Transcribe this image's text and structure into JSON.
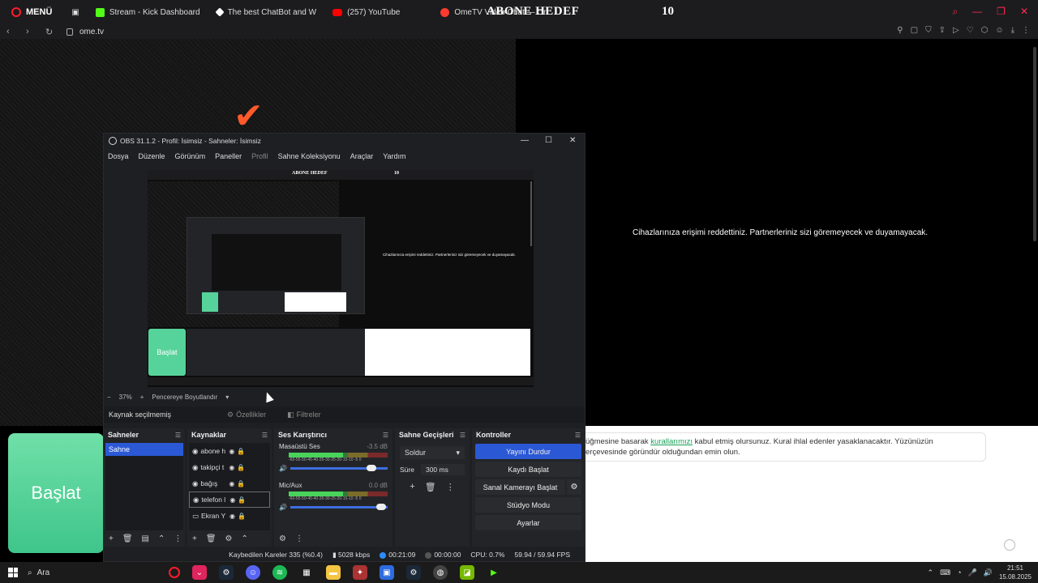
{
  "browser": {
    "menu_label": "MENÜ",
    "tabs": [
      {
        "label": "Stream - Kick Dashboard",
        "color": "#53fc18"
      },
      {
        "label": "The best ChatBot and W",
        "color": "#ffffff"
      },
      {
        "label": "(257) YouTube",
        "color": "#ff0000"
      },
      {
        "label": "OmeTV Video Chat — Or",
        "color": "#ff3b30"
      }
    ],
    "url": "ome.tv",
    "banner_title": "ABONE HEDEF",
    "banner_count": "10"
  },
  "page": {
    "deny_message": "Cihazlarınıza erişimi reddettiniz. Partnerleriniz sizi göremeyecek ve duyamayacak.",
    "start_label": "Başlat",
    "rules_pre": "üğmesine basarak ",
    "rules_link": "kurallarımızı",
    "rules_post": " kabul etmiş olursunuz. Kural ihlal edenler yasaklanacaktır. Yüzünüzün",
    "rules_line2": "erçevesinde göründür olduğundan emin olun."
  },
  "obs": {
    "title": "OBS 31.1.2 - Profil: İsimsiz - Sahneler: İsimsiz",
    "menu": [
      "Dosya",
      "Düzenle",
      "Görünüm",
      "Paneller",
      "Profil",
      "Sahne Koleksiyonu",
      "Araçlar",
      "Yardım"
    ],
    "preview_banner": "ABONE HEDEF",
    "preview_count": "10",
    "preview_start": "Başlat",
    "zoom": "37%",
    "fit_label": "Pencereye Boyutlandır",
    "no_source": "Kaynak seçilmemiş",
    "properties": "Özellikler",
    "filters": "Filtreler",
    "scenes": {
      "title": "Sahneler",
      "items": [
        "Sahne"
      ]
    },
    "sources": {
      "title": "Kaynaklar",
      "items": [
        "abone h",
        "takipçi t",
        "bağış",
        "telefon l",
        "Ekran Y"
      ]
    },
    "mixer": {
      "title": "Ses Karıştırıcı",
      "channels": [
        {
          "name": "Masaüstü Ses",
          "db": "-3.5 dB",
          "level": 0.55,
          "volume": 0.88
        },
        {
          "name": "Mic/Aux",
          "db": "0.0 dB",
          "level": 0.45,
          "volume": 1.0
        }
      ],
      "ticks": "-60-55-50-45-40-35-30-25-20-15-10 -5 0"
    },
    "transitions": {
      "title": "Sahne Geçişleri",
      "type": "Soldur",
      "duration_label": "Süre",
      "duration": "300 ms"
    },
    "controls": {
      "title": "Kontroller",
      "stop_stream": "Yayını Durdur",
      "start_record": "Kaydı Başlat",
      "virtual_cam": "Sanal Kamerayı Başlat",
      "studio_mode": "Stüdyo Modu",
      "settings": "Ayarlar"
    },
    "status": {
      "dropped": "Kaybedilen Kareler 335 (%0.4)",
      "bitrate": "5028 kbps",
      "stream_time": "00:21:09",
      "rec_time": "00:00:00",
      "cpu": "CPU: 0.7%",
      "fps": "59.94 / 59.94 FPS"
    }
  },
  "taskbar": {
    "search": "Ara",
    "time": "21:51",
    "date": "15.08.2025"
  }
}
